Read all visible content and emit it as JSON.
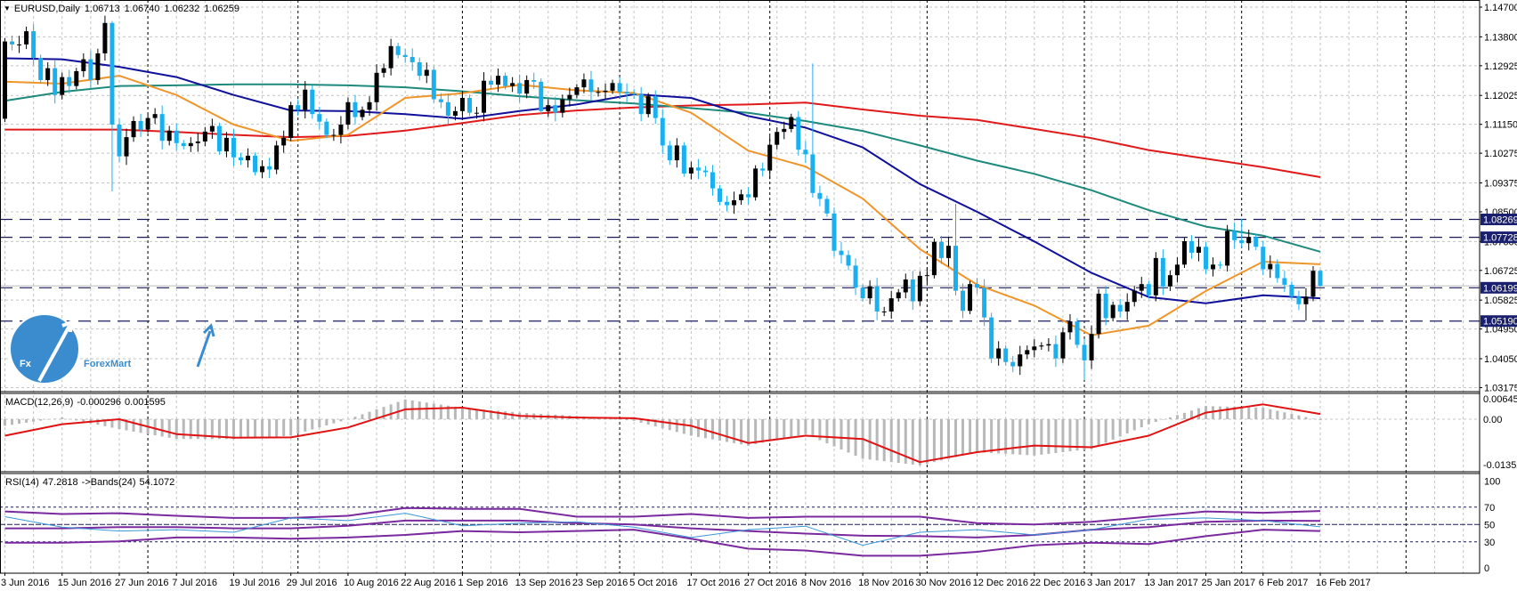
{
  "header": {
    "symbol_timeframe": "EURUSD,Daily",
    "open": "1.06713",
    "high": "1.06740",
    "low": "1.06232",
    "close": "1.06259",
    "menu_icon": "triangle-down-icon"
  },
  "indicators": {
    "macd_label": "MACD(12,26,9)",
    "macd_value": "-0.000296",
    "macd_signal": "0.001595",
    "rsi_label": "RSI(14)",
    "rsi_value": "47.2818",
    "bands_label": "->Bands(24)",
    "bands_value": "54.1072"
  },
  "logo": {
    "mark": "Fx",
    "text": "ForexMart"
  },
  "colors": {
    "bull": "#000000",
    "bear": "#1ab0f0",
    "grid": "#c4c4c4",
    "level_line": "#1c1c5c",
    "badge_bg": "#1a1f6e",
    "macd_hist": "#b8b8b8",
    "macd_signal": "#e01212",
    "rsi_line": "#3a98d8",
    "rsi_bands": "#7a2a9e",
    "logo": "#3a8ccf"
  },
  "chart_data": [
    {
      "type": "candlestick",
      "title": "EURUSD,Daily",
      "x_labels": [
        "3 Jun 2016",
        "15 Jun 2016",
        "27 Jun 2016",
        "7 Jul 2016",
        "19 Jul 2016",
        "29 Jul 2016",
        "10 Aug 2016",
        "22 Aug 2016",
        "1 Sep 2016",
        "13 Sep 2016",
        "23 Sep 2016",
        "5 Oct 2016",
        "17 Oct 2016",
        "27 Oct 2016",
        "8 Nov 2016",
        "18 Nov 2016",
        "30 Nov 2016",
        "12 Dec 2016",
        "22 Dec 2016",
        "3 Jan 2017",
        "13 Jan 2017",
        "25 Jan 2017",
        "6 Feb 2017",
        "16 Feb 2017"
      ],
      "label_every_bars": 8,
      "first_open": 1.1132,
      "closes": [
        1.1366,
        1.1357,
        1.1357,
        1.1397,
        1.1316,
        1.1249,
        1.1285,
        1.1204,
        1.1258,
        1.1231,
        1.1276,
        1.1312,
        1.1249,
        1.133,
        1.1422,
        1.1114,
        1.1018,
        1.1076,
        1.1125,
        1.1099,
        1.1134,
        1.1146,
        1.1065,
        1.1096,
        1.1058,
        1.1049,
        1.1058,
        1.1063,
        1.1093,
        1.111,
        1.1033,
        1.1074,
        1.1015,
        1.1006,
        1.102,
        1.097,
        1.0988,
        1.0978,
        1.1051,
        1.1074,
        1.1173,
        1.1159,
        1.122,
        1.1146,
        1.1123,
        1.1083,
        1.1083,
        1.1114,
        1.1182,
        1.1137,
        1.1159,
        1.1182,
        1.1271,
        1.1285,
        1.1352,
        1.1325,
        1.1319,
        1.1303,
        1.1262,
        1.128,
        1.1191,
        1.1182,
        1.1141,
        1.1155,
        1.1195,
        1.115,
        1.115,
        1.1247,
        1.1235,
        1.1262,
        1.1231,
        1.124,
        1.1208,
        1.1249,
        1.1244,
        1.1155,
        1.1173,
        1.115,
        1.1191,
        1.1204,
        1.1227,
        1.1251,
        1.1213,
        1.1213,
        1.1217,
        1.124,
        1.1213,
        1.1208,
        1.1206,
        1.1146,
        1.12,
        1.1134,
        1.1051,
        1.1006,
        1.1051,
        1.0966,
        1.0984,
        1.0975,
        1.097,
        1.0921,
        1.088,
        1.087,
        1.0885,
        1.0903,
        1.0894,
        1.0981,
        1.0975,
        1.1053,
        1.1092,
        1.1101,
        1.1137,
        1.1038,
        1.1024,
        1.0907,
        1.0889,
        1.0845,
        1.0732,
        1.0719,
        1.0687,
        1.062,
        1.0588,
        1.0624,
        1.0548,
        1.0548,
        1.0588,
        1.0606,
        1.0645,
        1.0579,
        1.0656,
        1.0658,
        1.0759,
        1.071,
        1.0747,
        1.0611,
        1.055,
        1.0631,
        1.062,
        1.053,
        1.0406,
        1.0436,
        1.0395,
        1.0382,
        1.0418,
        1.0431,
        1.0442,
        1.0445,
        1.0449,
        1.0406,
        1.0485,
        1.0518,
        1.0447,
        1.04,
        1.048,
        1.0602,
        1.0528,
        1.0568,
        1.0548,
        1.0577,
        1.0611,
        1.0631,
        1.0597,
        1.071,
        1.0624,
        1.0658,
        1.069,
        1.0761,
        1.0726,
        1.0744,
        1.0676,
        1.069,
        1.0687,
        1.0792,
        1.0764,
        1.0755,
        1.0774,
        1.0744,
        1.0676,
        1.0692,
        1.0649,
        1.0629,
        1.0593,
        1.057,
        1.0593,
        1.06713,
        1.06259
      ],
      "last_bar": {
        "open": 1.06713,
        "high": 1.0674,
        "low": 1.06232,
        "close": 1.06259
      },
      "wick_extremes": [
        {
          "bar": 15,
          "high": 1.1428,
          "low": 1.0912
        },
        {
          "bar": 113,
          "high": 1.1299
        },
        {
          "bar": 133,
          "high": 1.0874
        },
        {
          "bar": 151,
          "low": 1.034
        },
        {
          "bar": 173,
          "high": 1.0829
        },
        {
          "bar": 182,
          "low": 1.052
        }
      ],
      "y_ticks": [
        "1.14700",
        "1.13800",
        "1.12925",
        "1.12025",
        "1.11150",
        "1.10275",
        "1.09375",
        "1.08500",
        "1.07600",
        "1.06725",
        "1.05825",
        "1.04950",
        "1.04050",
        "1.03175"
      ],
      "ylim": [
        1.03,
        1.149
      ],
      "moving_average_sample_every_bars": 8,
      "moving_averages": [
        {
          "name": "ma-red",
          "color": "#e01a1a",
          "values": [
            1.1099,
            1.1099,
            1.1099,
            1.1092,
            1.1083,
            1.1076,
            1.108,
            1.1096,
            1.1119,
            1.1143,
            1.1157,
            1.1166,
            1.1172,
            1.1175,
            1.1181,
            1.116,
            1.1141,
            1.1128,
            1.1101,
            1.1073,
            1.1037,
            1.1011,
            1.0985,
            1.0955
          ]
        },
        {
          "name": "ma-teal",
          "color": "#1d8a7c",
          "values": [
            1.1186,
            1.1213,
            1.1231,
            1.1233,
            1.1236,
            1.1236,
            1.1233,
            1.1227,
            1.1215,
            1.12,
            1.1188,
            1.1178,
            1.1164,
            1.115,
            1.1125,
            1.1095,
            1.1051,
            1.1005,
            1.0965,
            1.0915,
            1.0855,
            1.0805,
            1.0778,
            1.0729
          ]
        },
        {
          "name": "ma-blue",
          "color": "#10109a",
          "values": [
            1.1315,
            1.1312,
            1.1289,
            1.1258,
            1.1204,
            1.1157,
            1.1155,
            1.1146,
            1.1132,
            1.1155,
            1.1175,
            1.1206,
            1.1195,
            1.114,
            1.1105,
            1.1045,
            1.0934,
            1.085,
            1.076,
            1.0665,
            1.0592,
            1.0573,
            1.0597,
            1.0588
          ]
        },
        {
          "name": "ma-orange",
          "color": "#f0952a",
          "values": [
            1.1244,
            1.1238,
            1.1262,
            1.1204,
            1.1114,
            1.1065,
            1.1083,
            1.1195,
            1.1209,
            1.1235,
            1.1218,
            1.121,
            1.115,
            1.1035,
            1.0987,
            1.089,
            1.0737,
            1.0629,
            1.0566,
            1.0476,
            1.0505,
            1.061,
            1.0699,
            1.0691
          ]
        }
      ],
      "horizontal_levels": [
        "1.08269",
        "1.07728",
        "1.06199",
        "1.05190"
      ],
      "bid": 1.06259
    },
    {
      "type": "bar+line",
      "name": "MACD(12,26,9)",
      "sample_every_bars": 8,
      "y_ticks": [
        "0.006457",
        "0.00",
        "-0.01352"
      ],
      "histogram": [
        -0.002,
        0.0005,
        -0.003,
        -0.006,
        -0.006,
        -0.005,
        0.0,
        0.006,
        0.0035,
        0.002,
        0.001,
        -0.0005,
        -0.005,
        -0.008,
        -0.0045,
        -0.012,
        -0.014,
        -0.01,
        -0.011,
        -0.009,
        -0.0015,
        0.004,
        0.0035,
        -0.0003
      ],
      "signal": [
        -0.005,
        -0.0015,
        0.0,
        -0.0045,
        -0.0056,
        -0.0055,
        -0.0025,
        0.003,
        0.0035,
        0.001,
        0.0005,
        0.0003,
        -0.002,
        -0.0072,
        -0.005,
        -0.006,
        -0.013,
        -0.01,
        -0.008,
        -0.0085,
        -0.005,
        0.002,
        0.0045,
        0.0016
      ]
    },
    {
      "type": "line",
      "name": "RSI(14)",
      "sample_every_bars": 8,
      "ylim": [
        0,
        100
      ],
      "y_ticks": [
        "100",
        "70",
        "50",
        "30",
        "0"
      ],
      "levels": [
        70,
        50,
        30
      ],
      "rsi": [
        59,
        47,
        42.5,
        44,
        41,
        57.5,
        54.5,
        63,
        48.5,
        51.5,
        53,
        47,
        35,
        44,
        48,
        26,
        41,
        44,
        38,
        44,
        56,
        57.5,
        54.5,
        47.28
      ],
      "band_upper": [
        65,
        62,
        63,
        60,
        57.5,
        57.5,
        60,
        69,
        68,
        68,
        59,
        59,
        62,
        57.5,
        59,
        59,
        59,
        51.5,
        50,
        53,
        59,
        65,
        63.5,
        65.5
      ],
      "band_mid": [
        45.5,
        45.5,
        47,
        47,
        45.5,
        45.5,
        48.5,
        54.5,
        54.5,
        54.5,
        51.5,
        50,
        45.5,
        42.5,
        39.5,
        37,
        36.5,
        35,
        38,
        44,
        47,
        53,
        54.5,
        54.11
      ],
      "band_lower": [
        29,
        29,
        30.5,
        35,
        35,
        33.5,
        35,
        38,
        42.5,
        41,
        42.5,
        44,
        33.5,
        22,
        20,
        14,
        14,
        18.5,
        26,
        29,
        27.5,
        36.5,
        44,
        42.5
      ]
    }
  ]
}
